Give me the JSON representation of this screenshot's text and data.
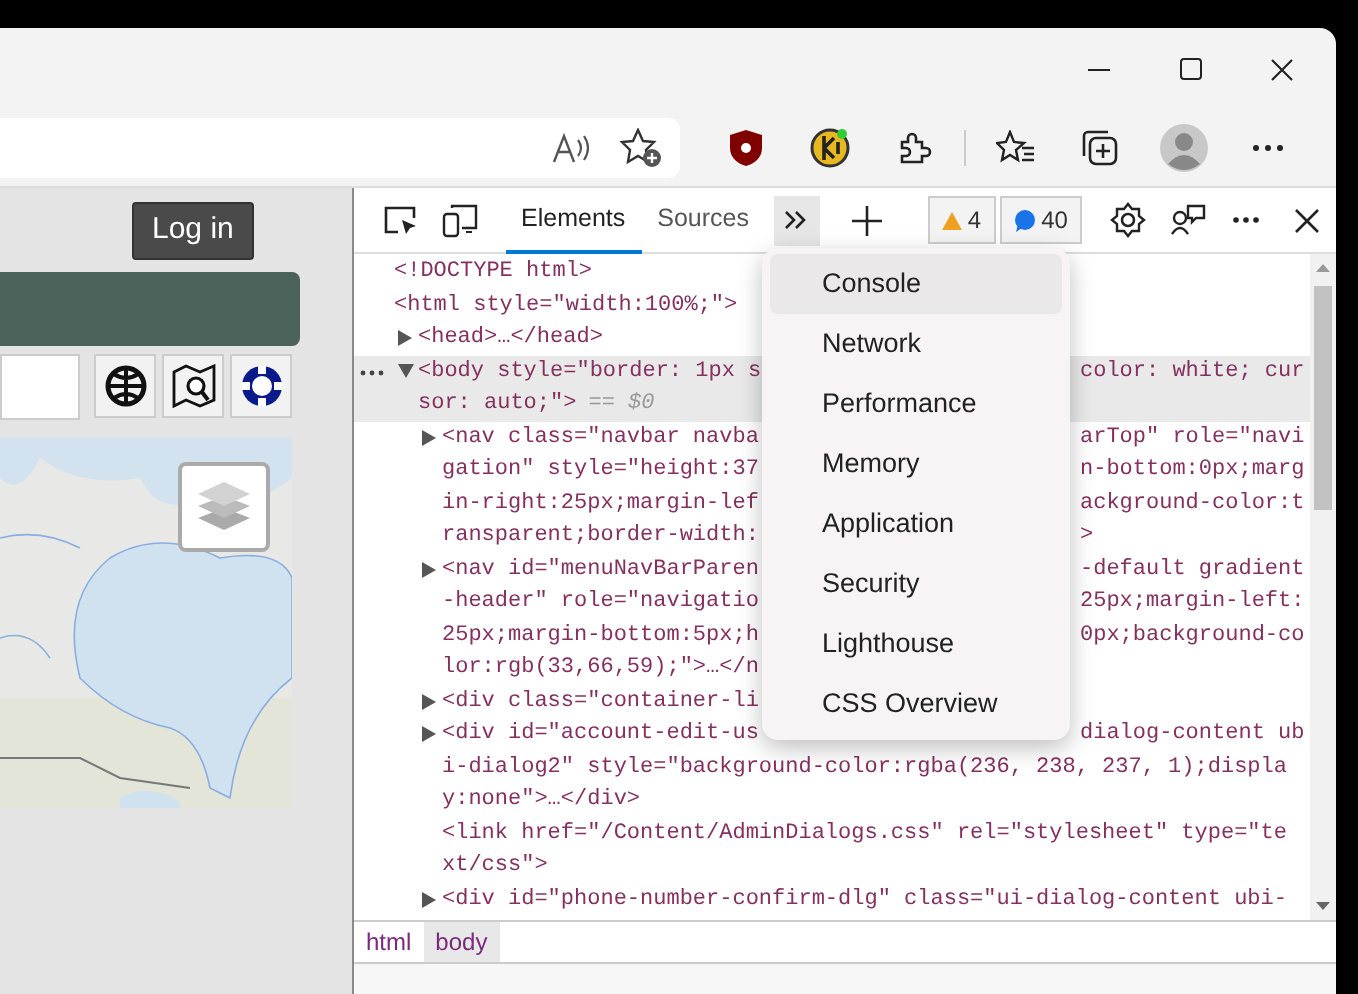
{
  "page": {
    "login_button": "Log in"
  },
  "devtools": {
    "tabs": [
      {
        "label": "Elements",
        "selected": true
      },
      {
        "label": "Sources",
        "selected": false
      }
    ],
    "overflow_menu_open": true,
    "warnings": "4",
    "messages": "40",
    "dom_tree": [
      {
        "kind": "leaf",
        "selected": false,
        "lines": [
          {
            "text": "<!DOCTYPE html>"
          }
        ]
      },
      {
        "kind": "leaf",
        "selected": false,
        "lines": [
          {
            "text": "<html style=\"width:100%;\">"
          }
        ],
        "children": [
          {
            "kind": "collapsed",
            "selected": false,
            "lines": [
              {
                "text": "<head>…</head>"
              }
            ]
          },
          {
            "kind": "expanded",
            "selected": true,
            "lines": [
              {
                "text": "<body style=\"border: 1px s",
                "after": "color: white; cur"
              },
              {
                "text": "sor: auto;\">",
                "note": "== $0"
              }
            ],
            "children": [
              {
                "kind": "collapsed",
                "selected": false,
                "lines": [
                  {
                    "text": "<nav class=\"navbar navba",
                    "after": "arTop\" role=\"navi"
                  },
                  {
                    "text": "gation\" style=\"height:37",
                    "after": "n-bottom:0px;marg"
                  },
                  {
                    "text": "in-right:25px;margin-lef",
                    "after": "ackground-color:t"
                  },
                  {
                    "text": "ransparent;border-width:",
                    "after": ">"
                  }
                ]
              },
              {
                "kind": "collapsed",
                "selected": false,
                "lines": [
                  {
                    "text": "<nav id=\"menuNavBarParen",
                    "after": "-default gradient"
                  },
                  {
                    "text": "-header\" role=\"navigatio",
                    "after": "25px;margin-left:"
                  },
                  {
                    "text": "25px;margin-bottom:5px;h",
                    "after": "0px;background-co"
                  },
                  {
                    "text": "lor:rgb(33,66,59);\">…</n"
                  }
                ]
              },
              {
                "kind": "collapsed",
                "selected": false,
                "lines": [
                  {
                    "text": "<div class=\"container-li"
                  }
                ]
              },
              {
                "kind": "collapsed",
                "selected": false,
                "lines": [
                  {
                    "text": "<div id=\"account-edit-us",
                    "after": "dialog-content ub"
                  },
                  {
                    "text": "i-dialog2\" style=\"background-color:rgba(236, 238, 237, 1);displa"
                  },
                  {
                    "text": "y:none\">…</div>"
                  }
                ]
              },
              {
                "kind": "leaf",
                "selected": false,
                "lines": [
                  {
                    "text": "<link href=\"/Content/AdminDialogs.css\" rel=\"stylesheet\" type=\"te"
                  },
                  {
                    "text": "xt/css\">"
                  }
                ]
              },
              {
                "kind": "collapsed",
                "selected": false,
                "lines": [
                  {
                    "text": "<div id=\"phone-number-confirm-dlg\" class=\"ui-dialog-content ubi-"
                  }
                ]
              }
            ]
          }
        ]
      }
    ],
    "more_tools_menu": [
      {
        "label": "Console",
        "selected": true
      },
      {
        "label": "Network",
        "selected": false
      },
      {
        "label": "Performance",
        "selected": false
      },
      {
        "label": "Memory",
        "selected": false
      },
      {
        "label": "Application",
        "selected": false
      },
      {
        "label": "Security",
        "selected": false
      },
      {
        "label": "Lighthouse",
        "selected": false
      },
      {
        "label": "CSS Overview",
        "selected": false
      }
    ],
    "breadcrumbs": [
      {
        "label": "html",
        "selected": false
      },
      {
        "label": "body",
        "selected": true
      }
    ]
  }
}
